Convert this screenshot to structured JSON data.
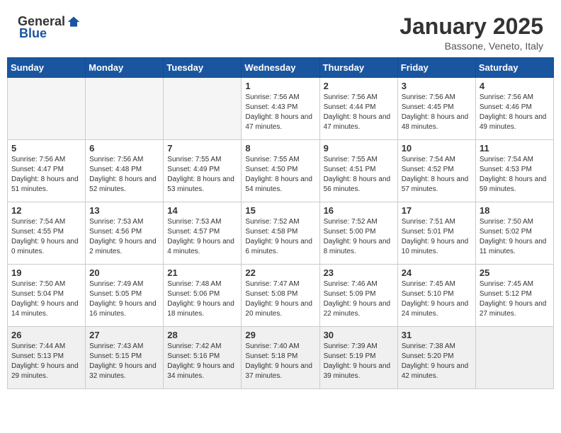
{
  "header": {
    "logo_general": "General",
    "logo_blue": "Blue",
    "month_year": "January 2025",
    "location": "Bassone, Veneto, Italy"
  },
  "weekdays": [
    "Sunday",
    "Monday",
    "Tuesday",
    "Wednesday",
    "Thursday",
    "Friday",
    "Saturday"
  ],
  "weeks": [
    [
      {
        "day": "",
        "sunrise": "",
        "sunset": "",
        "daylight": ""
      },
      {
        "day": "",
        "sunrise": "",
        "sunset": "",
        "daylight": ""
      },
      {
        "day": "",
        "sunrise": "",
        "sunset": "",
        "daylight": ""
      },
      {
        "day": "1",
        "sunrise": "Sunrise: 7:56 AM",
        "sunset": "Sunset: 4:43 PM",
        "daylight": "Daylight: 8 hours and 47 minutes."
      },
      {
        "day": "2",
        "sunrise": "Sunrise: 7:56 AM",
        "sunset": "Sunset: 4:44 PM",
        "daylight": "Daylight: 8 hours and 47 minutes."
      },
      {
        "day": "3",
        "sunrise": "Sunrise: 7:56 AM",
        "sunset": "Sunset: 4:45 PM",
        "daylight": "Daylight: 8 hours and 48 minutes."
      },
      {
        "day": "4",
        "sunrise": "Sunrise: 7:56 AM",
        "sunset": "Sunset: 4:46 PM",
        "daylight": "Daylight: 8 hours and 49 minutes."
      }
    ],
    [
      {
        "day": "5",
        "sunrise": "Sunrise: 7:56 AM",
        "sunset": "Sunset: 4:47 PM",
        "daylight": "Daylight: 8 hours and 51 minutes."
      },
      {
        "day": "6",
        "sunrise": "Sunrise: 7:56 AM",
        "sunset": "Sunset: 4:48 PM",
        "daylight": "Daylight: 8 hours and 52 minutes."
      },
      {
        "day": "7",
        "sunrise": "Sunrise: 7:55 AM",
        "sunset": "Sunset: 4:49 PM",
        "daylight": "Daylight: 8 hours and 53 minutes."
      },
      {
        "day": "8",
        "sunrise": "Sunrise: 7:55 AM",
        "sunset": "Sunset: 4:50 PM",
        "daylight": "Daylight: 8 hours and 54 minutes."
      },
      {
        "day": "9",
        "sunrise": "Sunrise: 7:55 AM",
        "sunset": "Sunset: 4:51 PM",
        "daylight": "Daylight: 8 hours and 56 minutes."
      },
      {
        "day": "10",
        "sunrise": "Sunrise: 7:54 AM",
        "sunset": "Sunset: 4:52 PM",
        "daylight": "Daylight: 8 hours and 57 minutes."
      },
      {
        "day": "11",
        "sunrise": "Sunrise: 7:54 AM",
        "sunset": "Sunset: 4:53 PM",
        "daylight": "Daylight: 8 hours and 59 minutes."
      }
    ],
    [
      {
        "day": "12",
        "sunrise": "Sunrise: 7:54 AM",
        "sunset": "Sunset: 4:55 PM",
        "daylight": "Daylight: 9 hours and 0 minutes."
      },
      {
        "day": "13",
        "sunrise": "Sunrise: 7:53 AM",
        "sunset": "Sunset: 4:56 PM",
        "daylight": "Daylight: 9 hours and 2 minutes."
      },
      {
        "day": "14",
        "sunrise": "Sunrise: 7:53 AM",
        "sunset": "Sunset: 4:57 PM",
        "daylight": "Daylight: 9 hours and 4 minutes."
      },
      {
        "day": "15",
        "sunrise": "Sunrise: 7:52 AM",
        "sunset": "Sunset: 4:58 PM",
        "daylight": "Daylight: 9 hours and 6 minutes."
      },
      {
        "day": "16",
        "sunrise": "Sunrise: 7:52 AM",
        "sunset": "Sunset: 5:00 PM",
        "daylight": "Daylight: 9 hours and 8 minutes."
      },
      {
        "day": "17",
        "sunrise": "Sunrise: 7:51 AM",
        "sunset": "Sunset: 5:01 PM",
        "daylight": "Daylight: 9 hours and 10 minutes."
      },
      {
        "day": "18",
        "sunrise": "Sunrise: 7:50 AM",
        "sunset": "Sunset: 5:02 PM",
        "daylight": "Daylight: 9 hours and 11 minutes."
      }
    ],
    [
      {
        "day": "19",
        "sunrise": "Sunrise: 7:50 AM",
        "sunset": "Sunset: 5:04 PM",
        "daylight": "Daylight: 9 hours and 14 minutes."
      },
      {
        "day": "20",
        "sunrise": "Sunrise: 7:49 AM",
        "sunset": "Sunset: 5:05 PM",
        "daylight": "Daylight: 9 hours and 16 minutes."
      },
      {
        "day": "21",
        "sunrise": "Sunrise: 7:48 AM",
        "sunset": "Sunset: 5:06 PM",
        "daylight": "Daylight: 9 hours and 18 minutes."
      },
      {
        "day": "22",
        "sunrise": "Sunrise: 7:47 AM",
        "sunset": "Sunset: 5:08 PM",
        "daylight": "Daylight: 9 hours and 20 minutes."
      },
      {
        "day": "23",
        "sunrise": "Sunrise: 7:46 AM",
        "sunset": "Sunset: 5:09 PM",
        "daylight": "Daylight: 9 hours and 22 minutes."
      },
      {
        "day": "24",
        "sunrise": "Sunrise: 7:45 AM",
        "sunset": "Sunset: 5:10 PM",
        "daylight": "Daylight: 9 hours and 24 minutes."
      },
      {
        "day": "25",
        "sunrise": "Sunrise: 7:45 AM",
        "sunset": "Sunset: 5:12 PM",
        "daylight": "Daylight: 9 hours and 27 minutes."
      }
    ],
    [
      {
        "day": "26",
        "sunrise": "Sunrise: 7:44 AM",
        "sunset": "Sunset: 5:13 PM",
        "daylight": "Daylight: 9 hours and 29 minutes."
      },
      {
        "day": "27",
        "sunrise": "Sunrise: 7:43 AM",
        "sunset": "Sunset: 5:15 PM",
        "daylight": "Daylight: 9 hours and 32 minutes."
      },
      {
        "day": "28",
        "sunrise": "Sunrise: 7:42 AM",
        "sunset": "Sunset: 5:16 PM",
        "daylight": "Daylight: 9 hours and 34 minutes."
      },
      {
        "day": "29",
        "sunrise": "Sunrise: 7:40 AM",
        "sunset": "Sunset: 5:18 PM",
        "daylight": "Daylight: 9 hours and 37 minutes."
      },
      {
        "day": "30",
        "sunrise": "Sunrise: 7:39 AM",
        "sunset": "Sunset: 5:19 PM",
        "daylight": "Daylight: 9 hours and 39 minutes."
      },
      {
        "day": "31",
        "sunrise": "Sunrise: 7:38 AM",
        "sunset": "Sunset: 5:20 PM",
        "daylight": "Daylight: 9 hours and 42 minutes."
      },
      {
        "day": "",
        "sunrise": "",
        "sunset": "",
        "daylight": ""
      }
    ]
  ]
}
